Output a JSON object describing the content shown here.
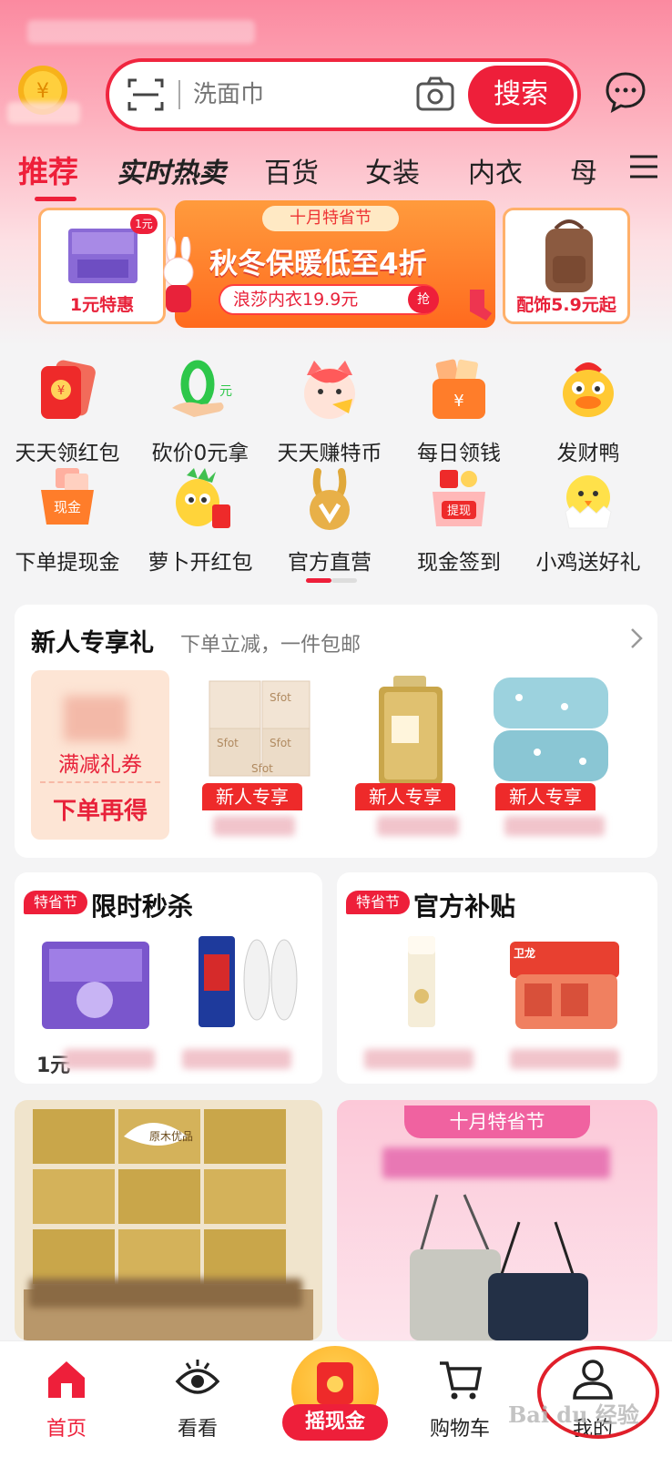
{
  "search": {
    "placeholder": "洗面巾",
    "button": "搜索"
  },
  "tabs": [
    "推荐",
    "实时热卖",
    "百货",
    "女装",
    "内衣",
    "母"
  ],
  "banner": {
    "left_label": "1元特惠",
    "left_badge": "1元",
    "mid_tag": "十月特省节",
    "mid_title": "秋冬保暖低至4折",
    "mid_sub": "浪莎内衣19.9元",
    "mid_grab": "抢",
    "right_label": "配饰5.9元起"
  },
  "grid": [
    {
      "label": "天天领红包",
      "icon": "red-envelope-icon"
    },
    {
      "label": "砍价0元拿",
      "icon": "zero-yuan-hand-icon"
    },
    {
      "label": "天天赚特币",
      "icon": "lucky-cat-icon"
    },
    {
      "label": "每日领钱",
      "icon": "money-envelope-icon"
    },
    {
      "label": "发财鸭",
      "icon": "duck-icon"
    },
    {
      "label": "下单提现金",
      "icon": "cash-basket-icon"
    },
    {
      "label": "萝卜开红包",
      "icon": "radish-icon"
    },
    {
      "label": "官方直营",
      "icon": "rabbit-logo-icon"
    },
    {
      "label": "现金签到",
      "icon": "cash-box-icon"
    },
    {
      "label": "小鸡送好礼",
      "icon": "chick-icon"
    }
  ],
  "newuser": {
    "title": "新人专享礼",
    "sub": "下单立减，一件包邮",
    "coupon_label": "满减礼券",
    "coupon_button": "下单再得",
    "tags": [
      "新人专享",
      "新人专享",
      "新人专享"
    ],
    "products": [
      "Sfot",
      "Sfot",
      "Sfot",
      "Sfot"
    ]
  },
  "flash": {
    "badge": "特省节",
    "title": "限时秒杀",
    "price_prefix": "1元"
  },
  "subsidy": {
    "badge": "特省节",
    "title": "官方补贴",
    "brand_badge": "卫龙"
  },
  "promo": {
    "tag": "十月特省节",
    "box_brand": "原木优品"
  },
  "nav": [
    {
      "label": "首页",
      "icon": "home-icon"
    },
    {
      "label": "看看",
      "icon": "eye-icon"
    },
    {
      "label": "摇现金",
      "icon": "red-envelope-icon"
    },
    {
      "label": "购物车",
      "icon": "cart-icon"
    },
    {
      "label": "我的",
      "icon": "person-icon"
    }
  ],
  "watermark": "Bai du 经验",
  "colors": {
    "accent": "#ee1f3a",
    "orange": "#ff6a1e",
    "bg": "#f4f4f5"
  }
}
